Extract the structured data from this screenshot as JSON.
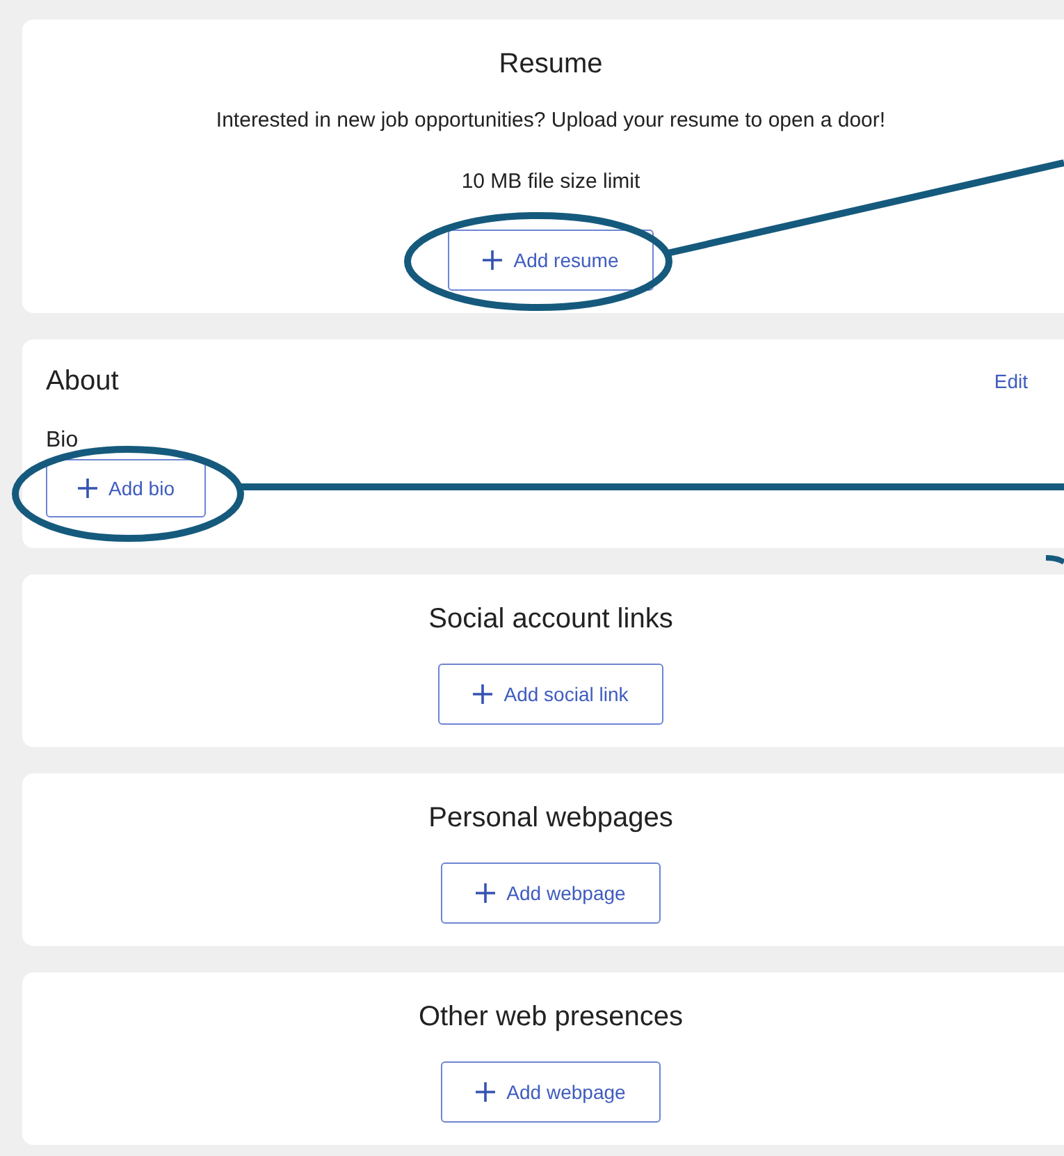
{
  "sections": [
    {
      "kind": "centered",
      "title": "Resume",
      "lines": [
        "Interested in new job opportunities? Upload your resume to open a door!",
        "10 MB file size limit"
      ],
      "action": "Add resume"
    },
    {
      "kind": "split",
      "title": "About",
      "edit": "Edit",
      "field_label": "Bio",
      "action": "Add bio"
    },
    {
      "kind": "centered",
      "title": "Social account links",
      "action": "Add social link"
    },
    {
      "kind": "centered",
      "title": "Personal webpages",
      "action": "Add webpage"
    },
    {
      "kind": "centered",
      "title": "Other web presences",
      "action": "Add webpage"
    }
  ]
}
